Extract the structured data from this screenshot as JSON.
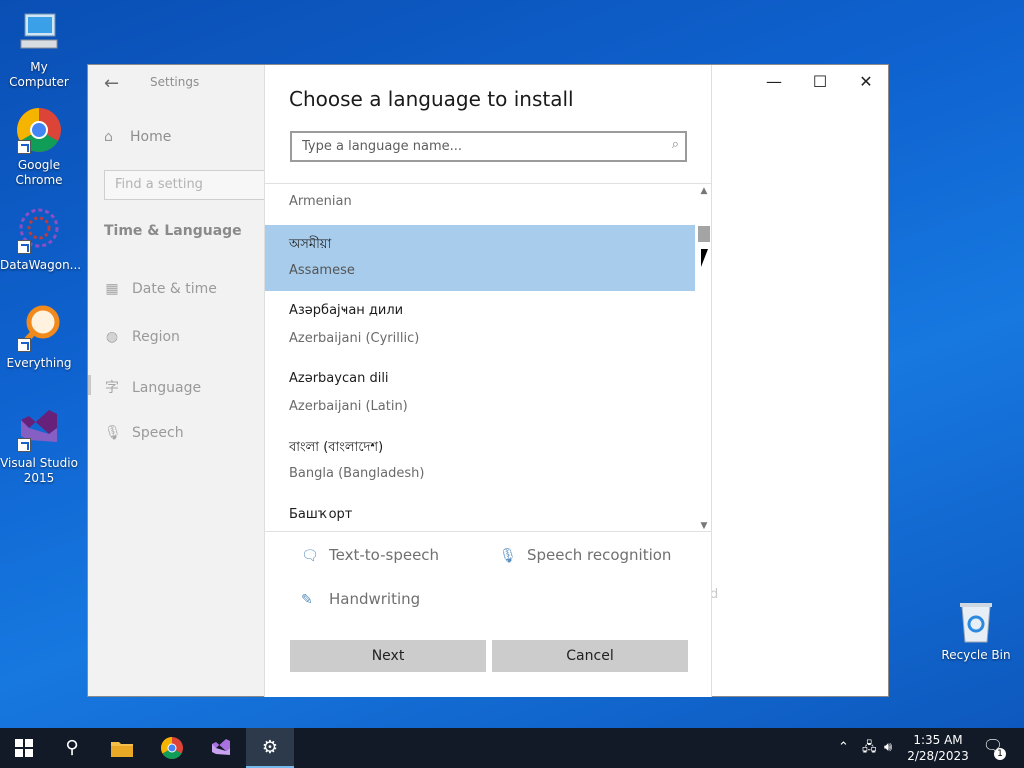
{
  "desktop": {
    "icons": [
      {
        "label": "My Computer",
        "icon": "computer-icon"
      },
      {
        "label": "Google Chrome",
        "icon": "chrome-icon"
      },
      {
        "label": "DataWagon...",
        "icon": "datawagon-icon"
      },
      {
        "label": "Everything",
        "icon": "search-icon"
      },
      {
        "label": "Visual Studio 2015",
        "icon": "visual-studio-icon"
      }
    ],
    "recycle_bin": "Recycle Bin"
  },
  "settings": {
    "app_title": "Settings",
    "home": "Home",
    "find_placeholder": "Find a setting",
    "section": "Time & Language",
    "nav": [
      "Date & time",
      "Region",
      "Language",
      "Speech"
    ],
    "ghost_text": "d"
  },
  "dialog": {
    "title": "Choose a language to install",
    "search_placeholder": "Type a language name...",
    "languages": [
      {
        "native": "",
        "english": "Armenian"
      },
      {
        "native": "অসমীয়া",
        "english": "Assamese",
        "selected": true
      },
      {
        "native": "Азәрбајҹан дили",
        "english": "Azerbaijani (Cyrillic)"
      },
      {
        "native": "Azərbaycan dili",
        "english": "Azerbaijani (Latin)"
      },
      {
        "native": "বাংলা (বাংলাদেশ)",
        "english": "Bangla (Bangladesh)"
      },
      {
        "native": "Башҡорт",
        "english": ""
      }
    ],
    "features": [
      "Text-to-speech",
      "Speech recognition",
      "Handwriting"
    ],
    "next_label": "Next",
    "cancel_label": "Cancel"
  },
  "taskbar": {
    "time": "1:35 AM",
    "date": "2/28/2023",
    "notification_count": "1"
  },
  "colors": {
    "selected_row": "#a8ccec",
    "taskbar": "#111a26",
    "accent": "#76b9ed"
  }
}
